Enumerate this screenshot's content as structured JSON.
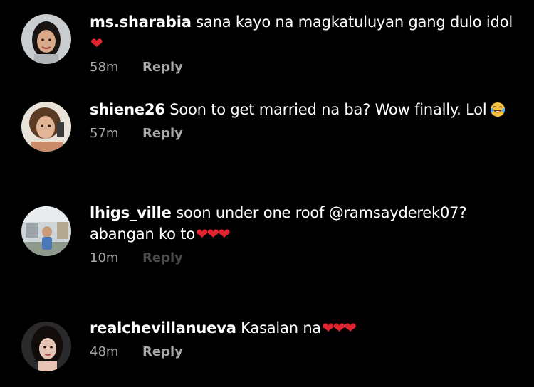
{
  "comments": [
    {
      "username": "ms.sharabia",
      "text": "sana kayo na magkatuluyan gang dulo idol",
      "hearts": "❤",
      "time": "58m",
      "reply_label": "Reply"
    },
    {
      "username": "shiene26",
      "text": "Soon to get married na ba? Wow finally.  Lol",
      "hearts": "",
      "time": "57m",
      "reply_label": "Reply"
    },
    {
      "username": "lhigs_ville",
      "text": "soon under one roof @ramsayderek07? abangan ko to",
      "hearts": "❤❤❤",
      "time": "10m",
      "reply_label": "Reply"
    },
    {
      "username": "realchevillanueva",
      "text": "Kasalan na",
      "hearts": "❤❤❤",
      "time": "48m",
      "reply_label": "Reply"
    }
  ],
  "colors": {
    "background": "#000000",
    "text": "#ffffff",
    "meta": "#a8a8a8",
    "heart": "#e0242f"
  },
  "icons": {
    "laugh_emoji": "face-with-tears-of-joy-icon",
    "heart": "red-heart-icon"
  }
}
